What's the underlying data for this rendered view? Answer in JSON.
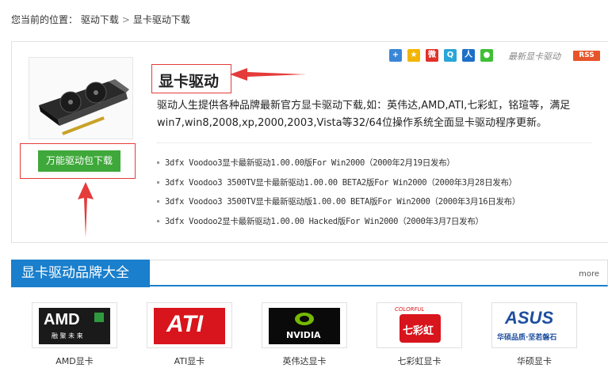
{
  "breadcrumb": {
    "prefix": "您当前的位置：",
    "items": [
      "驱动下载",
      "显卡驱动下载"
    ],
    "separator": ">"
  },
  "share": {
    "icons": [
      "plus-share-icon",
      "star-bookmark-icon",
      "weibo-icon",
      "qzone-icon",
      "renren-icon",
      "wechat-icon"
    ],
    "latest_label": "最新显卡驱动",
    "rss_label": "RSS"
  },
  "product": {
    "title": "显卡驱动",
    "description": "驱动人生提供各种品牌最新官方显卡驱动下载,如：英伟达,AMD,ATI,七彩虹，铭瑄等，满足win7,win8,2008,xp,2000,2003,Vista等32/64位操作系统全面显卡驱动程序更新。",
    "download_button": "万能驱动包下载"
  },
  "drivers": [
    "3dfx Voodoo3显卡最新驱动1.00.00版For Win2000（2000年2月19日发布）",
    "3dfx Voodoo3 3500TV显卡最新驱动1.00.00 BETA2版For Win2000（2000年3月28日发布）",
    "3dfx Voodoo3 3500TV显卡最新驱动版1.00.00 BETA版For Win2000（2000年3月16日发布）",
    "3dfx Voodoo2显卡最新驱动1.00.00 Hacked版For Win2000（2000年3月7日发布）"
  ],
  "brands_section": {
    "title": "显卡驱动品牌大全",
    "more_label": "more",
    "brands": [
      {
        "label": "AMD显卡",
        "logo_text": "AMD",
        "logo_sub": "融 聚 未 来",
        "color": "#1a1a1a"
      },
      {
        "label": "ATI显卡",
        "logo_text": "ATI",
        "color": "#d8141c"
      },
      {
        "label": "英伟达显卡",
        "logo_text": "NVIDIA",
        "color": "#0a0a0a"
      },
      {
        "label": "七彩虹显卡",
        "logo_text": "七彩虹",
        "logo_sub": "COLORFUL",
        "color": "#d8141c"
      },
      {
        "label": "华硕显卡",
        "logo_text": "ASUS",
        "logo_sub": "华硕品质·坚若磐石",
        "color": "#1d4e9e"
      }
    ]
  },
  "colors": {
    "accent_blue": "#1a7fcc",
    "button_green": "#3fa83a",
    "annotation_red": "#e53b3b",
    "rss_orange": "#e8542a"
  }
}
